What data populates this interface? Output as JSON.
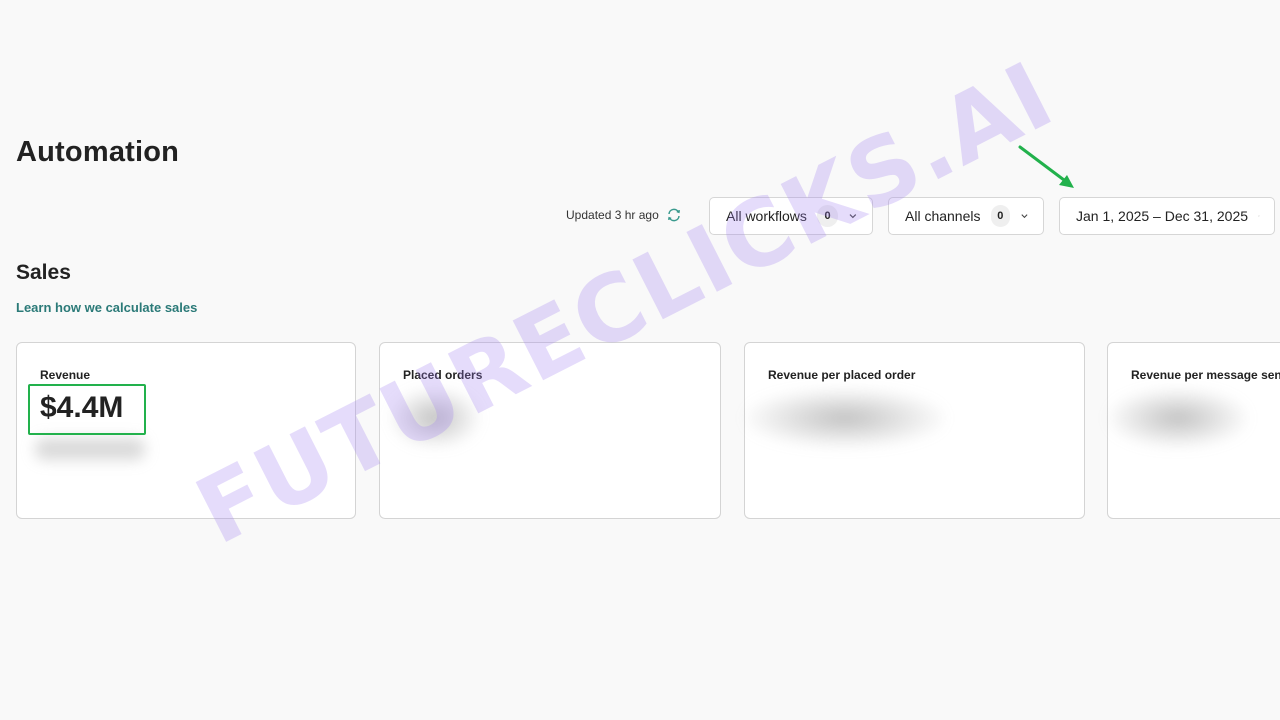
{
  "header": {
    "title": "Automation"
  },
  "toolbar": {
    "updated_text": "Updated 3 hr ago",
    "refresh_icon": "refresh-icon",
    "workflows": {
      "label": "All workflows",
      "count": "0"
    },
    "channels": {
      "label": "All channels",
      "count": "0"
    },
    "date_range": {
      "label": "Jan 1, 2025 – Dec 31, 2025"
    }
  },
  "sales": {
    "title": "Sales",
    "learn_link": "Learn how we calculate sales",
    "cards": [
      {
        "label": "Revenue",
        "value": "$4.4M"
      },
      {
        "label": "Placed orders"
      },
      {
        "label": "Revenue per placed order"
      },
      {
        "label": "Revenue per message sent"
      }
    ]
  },
  "annotation": {
    "highlight_color": "#22b14c",
    "arrow_color": "#22b14c"
  },
  "watermark": {
    "text": "FUTURECLICKS.AI",
    "color": "#a082f0"
  },
  "colors": {
    "link": "#2b7a78",
    "background": "#f9f9f9"
  }
}
